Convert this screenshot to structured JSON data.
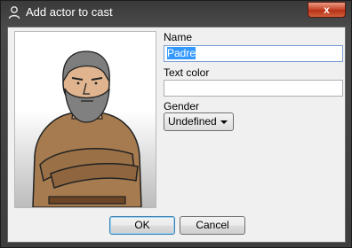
{
  "window": {
    "title": "Add actor to cast",
    "close_label": "x"
  },
  "preview": {
    "alt": "Actor portrait: bearded man in brown robe with crossed arms"
  },
  "form": {
    "name_label": "Name",
    "name_value": "Padre",
    "text_color_label": "Text color",
    "text_color_value": "",
    "gender_label": "Gender",
    "gender_value": "Undefined"
  },
  "buttons": {
    "ok": "OK",
    "cancel": "Cancel"
  }
}
